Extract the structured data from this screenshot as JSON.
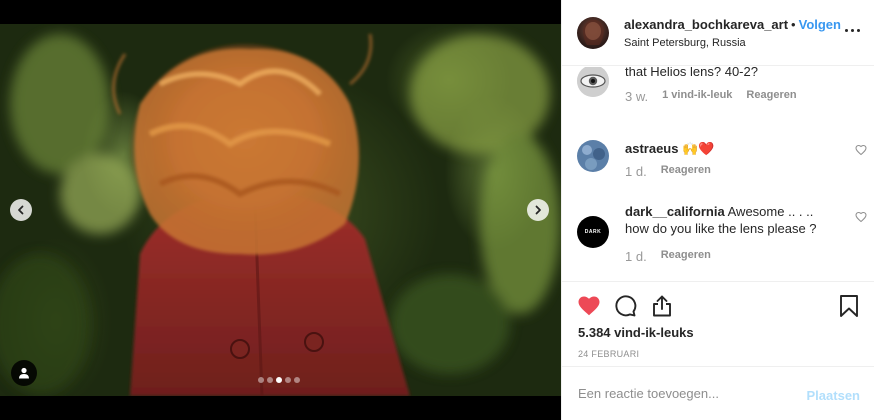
{
  "post": {
    "username": "alexandra_bochkareva_art",
    "separator": "•",
    "follow_label": "Volgen",
    "location": "Saint Petersburg, Russia",
    "carousel": {
      "slide_count": 5,
      "active_index": 2
    }
  },
  "comments": [
    {
      "username": "",
      "text": "that Helios lens? 40-2?",
      "time": "3 w.",
      "likes_label": "1 vind-ik-leuk",
      "reply_label": "Reageren",
      "avatar": "eye-avatar"
    },
    {
      "username": "astraeus",
      "text": "🙌❤️",
      "time": "1 d.",
      "reply_label": "Reageren",
      "avatar": "blue-avatar"
    },
    {
      "username": "dark__california",
      "text": "Awesome .. . .. how do you like the lens please ?",
      "time": "1 d.",
      "reply_label": "Reageren",
      "avatar": "dark-logo-avatar",
      "avatar_text": "DARK"
    }
  ],
  "actions": {
    "likes_text": "5.384 vind-ik-leuks",
    "date_text": "24 FEBRUARI",
    "liked": true,
    "heart_color": "#ed4956"
  },
  "add_comment": {
    "placeholder": "Een reactie toevoegen...",
    "post_label": "Plaatsen"
  },
  "colors": {
    "accent": "#3897f0",
    "post_disabled": "#b2dffc",
    "muted": "#8e8e8e"
  }
}
